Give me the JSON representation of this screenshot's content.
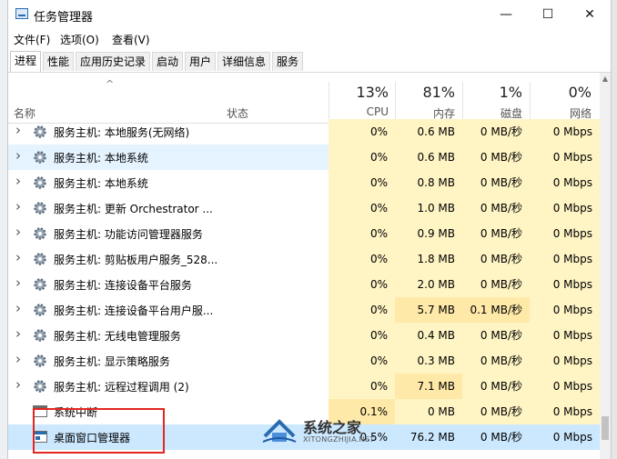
{
  "window": {
    "title": "任务管理器",
    "controls": {
      "minimize": "—",
      "maximize": "☐",
      "close": "✕"
    }
  },
  "menu": [
    "文件(F)",
    "选项(O)",
    "查看(V)"
  ],
  "tabs": [
    "进程",
    "性能",
    "应用历史记录",
    "启动",
    "用户",
    "详细信息",
    "服务"
  ],
  "active_tab": "进程",
  "columns": {
    "name": "名称",
    "status": "状态",
    "cpu": {
      "pct": "13%",
      "label": "CPU"
    },
    "memory": {
      "pct": "81%",
      "label": "内存"
    },
    "disk": {
      "pct": "1%",
      "label": "磁盘"
    },
    "network": {
      "pct": "0%",
      "label": "网络"
    }
  },
  "rows": [
    {
      "name": "服务主机: 本地服务(无网络)",
      "cpu": "0%",
      "mem": "0.6 MB",
      "disk": "0 MB/秒",
      "net": "0 Mbps",
      "icon": "gear-icon",
      "expand": true
    },
    {
      "name": "服务主机: 本地系统",
      "cpu": "0%",
      "mem": "0.6 MB",
      "disk": "0 MB/秒",
      "net": "0 Mbps",
      "icon": "gear-icon",
      "expand": true
    },
    {
      "name": "服务主机: 本地系统",
      "cpu": "0%",
      "mem": "0.8 MB",
      "disk": "0 MB/秒",
      "net": "0 Mbps",
      "icon": "gear-icon",
      "expand": true
    },
    {
      "name": "服务主机: 更新 Orchestrator ...",
      "cpu": "0%",
      "mem": "1.0 MB",
      "disk": "0 MB/秒",
      "net": "0 Mbps",
      "icon": "gear-icon",
      "expand": true
    },
    {
      "name": "服务主机: 功能访问管理器服务",
      "cpu": "0%",
      "mem": "0.9 MB",
      "disk": "0 MB/秒",
      "net": "0 Mbps",
      "icon": "gear-icon",
      "expand": true
    },
    {
      "name": "服务主机: 剪贴板用户服务_528...",
      "cpu": "0%",
      "mem": "1.8 MB",
      "disk": "0 MB/秒",
      "net": "0 Mbps",
      "icon": "gear-icon",
      "expand": true
    },
    {
      "name": "服务主机: 连接设备平台服务",
      "cpu": "0%",
      "mem": "2.0 MB",
      "disk": "0 MB/秒",
      "net": "0 Mbps",
      "icon": "gear-icon",
      "expand": true
    },
    {
      "name": "服务主机: 连接设备平台用户服...",
      "cpu": "0%",
      "mem": "5.7 MB",
      "disk": "0.1 MB/秒",
      "net": "0 Mbps",
      "icon": "gear-icon",
      "expand": true
    },
    {
      "name": "服务主机: 无线电管理服务",
      "cpu": "0%",
      "mem": "0.4 MB",
      "disk": "0 MB/秒",
      "net": "0 Mbps",
      "icon": "gear-icon",
      "expand": true
    },
    {
      "name": "服务主机: 显示策略服务",
      "cpu": "0%",
      "mem": "0.3 MB",
      "disk": "0 MB/秒",
      "net": "0 Mbps",
      "icon": "gear-icon",
      "expand": true
    },
    {
      "name": "服务主机: 远程过程调用 (2)",
      "cpu": "0%",
      "mem": "7.1 MB",
      "disk": "0 MB/秒",
      "net": "0 Mbps",
      "icon": "gear-icon",
      "expand": true
    },
    {
      "name": "系统中断",
      "cpu": "0.1%",
      "mem": "0 MB",
      "disk": "0 MB/秒",
      "net": "0 Mbps",
      "icon": "window-icon",
      "expand": false
    },
    {
      "name": "桌面窗口管理器",
      "cpu": "0.5%",
      "mem": "76.2 MB",
      "disk": "0 MB/秒",
      "net": "0 Mbps",
      "icon": "window-blue-icon",
      "expand": false
    }
  ],
  "watermark": {
    "title": "系统之家",
    "subtitle": "XITONGZHIJIA.NET"
  },
  "colors": {
    "heat_light": "#fff4c4",
    "heat_mid": "#ffe9a8",
    "selection": "#cce8ff",
    "highlight_box": "#e3261f"
  }
}
